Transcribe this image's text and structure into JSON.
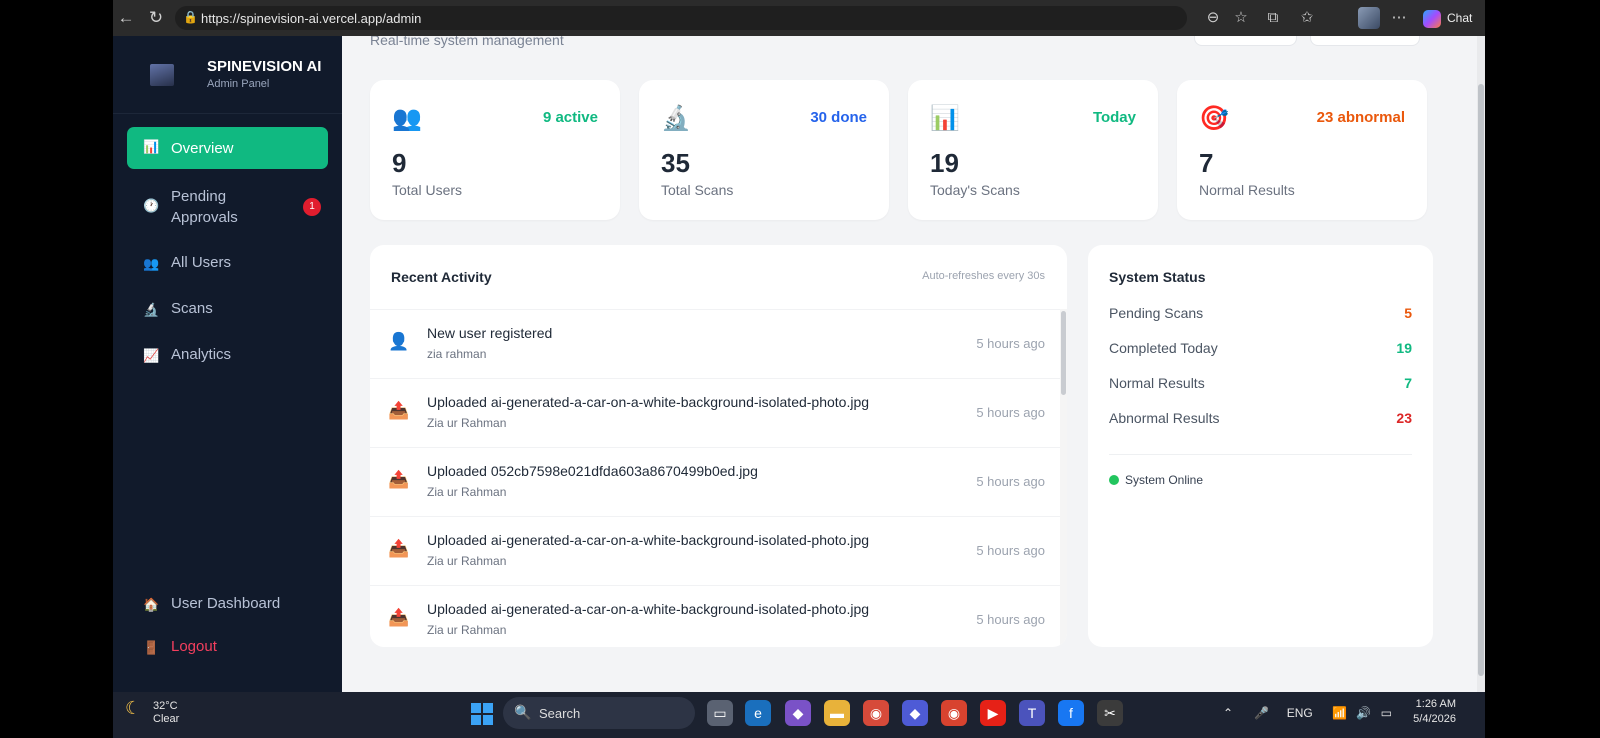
{
  "browser": {
    "url": "https://spinevision-ai.vercel.app/admin",
    "chat_label": "Chat"
  },
  "sidebar": {
    "brand_title": "SPINEVISION AI",
    "brand_subtitle": "Admin Panel",
    "items": [
      {
        "label": "Overview",
        "icon": "bar-chart-icon",
        "active": true
      },
      {
        "label": "Pending Approvals",
        "icon": "clock-icon",
        "badge": "1"
      },
      {
        "label": "All Users",
        "icon": "users-icon"
      },
      {
        "label": "Scans",
        "icon": "microscope-icon"
      },
      {
        "label": "Analytics",
        "icon": "line-chart-icon"
      }
    ],
    "bottom_items": [
      {
        "label": "User Dashboard",
        "icon": "house-icon"
      },
      {
        "label": "Logout",
        "icon": "door-icon"
      }
    ]
  },
  "header": {
    "subtitle": "Real-time system management"
  },
  "stats": [
    {
      "value": "9",
      "label": "Total Users",
      "tag": "9 active",
      "tag_color": "#10b981",
      "icon": "users-icon"
    },
    {
      "value": "35",
      "label": "Total Scans",
      "tag": "30 done",
      "tag_color": "#2563eb",
      "icon": "microscope-icon"
    },
    {
      "value": "19",
      "label": "Today's Scans",
      "tag": "Today",
      "tag_color": "#10b981",
      "icon": "bar-chart-icon"
    },
    {
      "value": "7",
      "label": "Normal Results",
      "tag": "23 abnormal",
      "tag_color": "#ea580c",
      "icon": "target-icon"
    }
  ],
  "activity": {
    "title": "Recent Activity",
    "note": "Auto-refreshes every 30s",
    "items": [
      {
        "title": "New user registered",
        "user": "zia rahman",
        "time": "5 hours ago",
        "icon": "user-icon"
      },
      {
        "title": "Uploaded ai-generated-a-car-on-a-white-background-isolated-photo.jpg",
        "user": "Zia ur Rahman",
        "time": "5 hours ago",
        "icon": "upload-icon"
      },
      {
        "title": "Uploaded 052cb7598e021dfda603a8670499b0ed.jpg",
        "user": "Zia ur Rahman",
        "time": "5 hours ago",
        "icon": "upload-icon"
      },
      {
        "title": "Uploaded ai-generated-a-car-on-a-white-background-isolated-photo.jpg",
        "user": "Zia ur Rahman",
        "time": "5 hours ago",
        "icon": "upload-icon"
      },
      {
        "title": "Uploaded ai-generated-a-car-on-a-white-background-isolated-photo.jpg",
        "user": "Zia ur Rahman",
        "time": "5 hours ago",
        "icon": "upload-icon"
      }
    ]
  },
  "system_status": {
    "title": "System Status",
    "rows": [
      {
        "label": "Pending Scans",
        "value": "5",
        "color": "#ea580c"
      },
      {
        "label": "Completed Today",
        "value": "19",
        "color": "#10b981"
      },
      {
        "label": "Normal Results",
        "value": "7",
        "color": "#10b981"
      },
      {
        "label": "Abnormal Results",
        "value": "23",
        "color": "#dc2626"
      }
    ],
    "online_label": "System Online"
  },
  "taskbar": {
    "weather_temp": "32°C",
    "weather_cond": "Clear",
    "search_label": "Search",
    "lang": "ENG",
    "time": "1:26 AM",
    "date": "5/4/2026"
  }
}
